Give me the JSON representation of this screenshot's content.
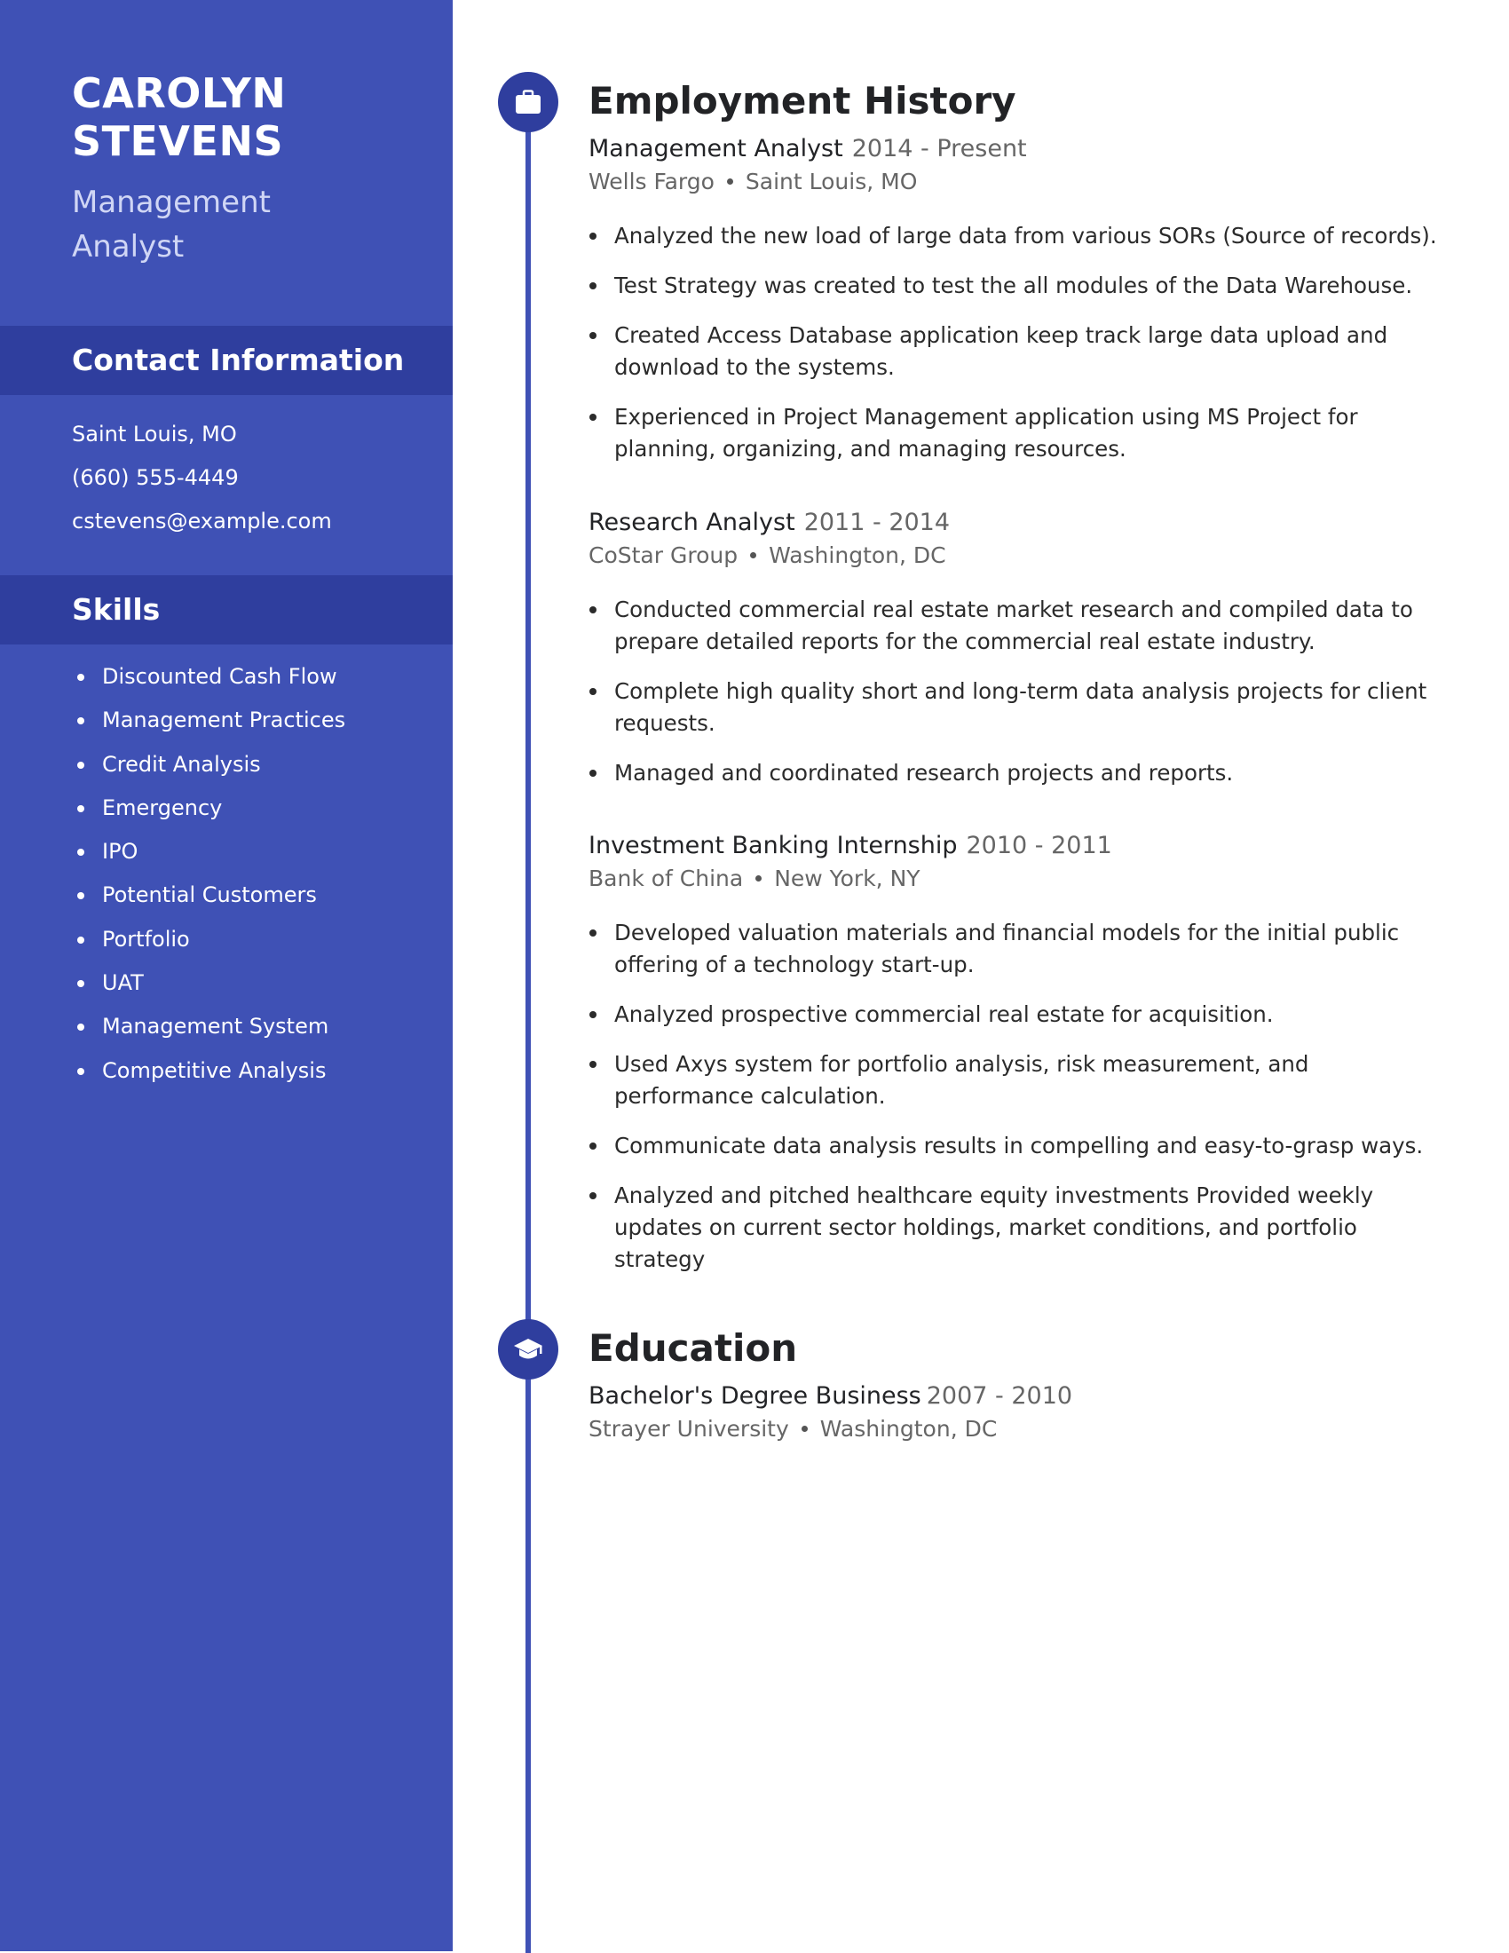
{
  "profile": {
    "first_name": "CAROLYN",
    "last_name": "STEVENS",
    "title_line1": "Management",
    "title_line2": "Analyst"
  },
  "contact": {
    "heading": "Contact Information",
    "location": "Saint Louis, MO",
    "phone": "(660) 555-4449",
    "email": "cstevens@example.com"
  },
  "skills": {
    "heading": "Skills",
    "items": [
      "Discounted Cash Flow",
      "Management Practices",
      "Credit Analysis",
      "Emergency",
      "IPO",
      "Potential Customers",
      "Portfolio",
      "UAT",
      "Management System",
      "Competitive Analysis"
    ]
  },
  "employment": {
    "heading": "Employment History",
    "icon": "briefcase-icon",
    "jobs": [
      {
        "title": "Management Analyst",
        "dates": "2014 - Present",
        "company": "Wells Fargo",
        "location": "Saint Louis, MO",
        "bullets": [
          "Analyzed the new load of large data from various SORs (Source of records).",
          "Test Strategy was created to test the all modules of the Data Warehouse.",
          "Created Access Database application keep track large data upload and download to the systems.",
          "Experienced in Project Management application using MS Project for planning, organizing, and managing resources."
        ]
      },
      {
        "title": "Research Analyst",
        "dates": "2011 - 2014",
        "company": "CoStar Group",
        "location": "Washington, DC",
        "bullets": [
          "Conducted commercial real estate market research and compiled data to prepare detailed reports for the commercial real estate industry.",
          "Complete high quality short and long-term data analysis projects for client requests.",
          "Managed and coordinated research projects and reports."
        ]
      },
      {
        "title": "Investment Banking Internship",
        "dates": "2010 - 2011",
        "company": "Bank of China",
        "location": "New York, NY",
        "bullets": [
          "Developed valuation materials and financial models for the initial public offering of a technology start-up.",
          "Analyzed prospective commercial real estate for acquisition.",
          "Used Axys system for portfolio analysis, risk measurement, and performance calculation.",
          "Communicate data analysis results in compelling and easy-to-grasp ways.",
          "Analyzed and pitched healthcare equity investments Provided weekly updates on current sector holdings, market conditions, and portfolio strategy"
        ]
      }
    ]
  },
  "education": {
    "heading": "Education",
    "icon": "graduation-cap-icon",
    "entries": [
      {
        "degree": "Bachelor's Degree Business",
        "dates": "2007 - 2010",
        "school": "Strayer University",
        "location": "Washington, DC"
      }
    ]
  },
  "colors": {
    "sidebar": "#3f51b5",
    "sidebar_band": "#2f3e9e",
    "timeline": "#3f51b5",
    "heading_text": "#222326",
    "muted_text": "#666666"
  }
}
